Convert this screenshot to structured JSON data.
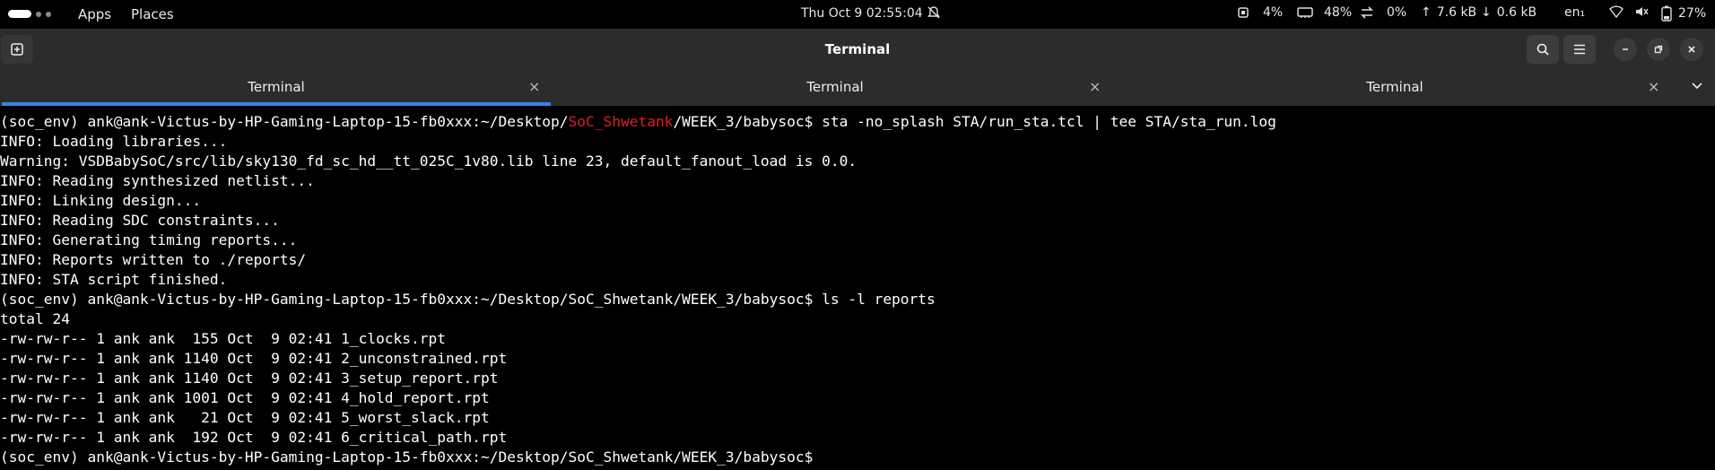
{
  "topbar": {
    "apps": "Apps",
    "places": "Places",
    "clock": "Thu Oct 9  02:55:04",
    "cpu": "4%",
    "mem": "48%",
    "swap": "0%",
    "up": "7.6 kB",
    "down": "0.6 kB",
    "lang": "en₁",
    "battery": "27%"
  },
  "header": {
    "title": "Terminal"
  },
  "tabs": [
    {
      "label": "Terminal",
      "active": true
    },
    {
      "label": "Terminal",
      "active": false
    },
    {
      "label": "Terminal",
      "active": false
    }
  ],
  "terminal": {
    "prompt_prefix": "(soc_env) ank@ank-Victus-by-HP-Gaming-Laptop-15-fb0xxx:~/Desktop/",
    "prompt_highlight": "SoC_Shwetank",
    "prompt_suffix": "/WEEK_3/babysoc$ sta -no_splash STA/run_sta.tcl | tee STA/sta_run.log",
    "lines": [
      "INFO: Loading libraries...",
      "Warning: VSDBabySoC/src/lib/sky130_fd_sc_hd__tt_025C_1v80.lib line 23, default_fanout_load is 0.0.",
      "INFO: Reading synthesized netlist...",
      "INFO: Linking design...",
      "INFO: Reading SDC constraints...",
      "INFO: Generating timing reports...",
      "INFO: Reports written to ./reports/",
      "INFO: STA script finished.",
      "(soc_env) ank@ank-Victus-by-HP-Gaming-Laptop-15-fb0xxx:~/Desktop/SoC_Shwetank/WEEK_3/babysoc$ ls -l reports",
      "total 24",
      "-rw-rw-r-- 1 ank ank  155 Oct  9 02:41 1_clocks.rpt",
      "-rw-rw-r-- 1 ank ank 1140 Oct  9 02:41 2_unconstrained.rpt",
      "-rw-rw-r-- 1 ank ank 1140 Oct  9 02:41 3_setup_report.rpt",
      "-rw-rw-r-- 1 ank ank 1001 Oct  9 02:41 4_hold_report.rpt",
      "-rw-rw-r-- 1 ank ank   21 Oct  9 02:41 5_worst_slack.rpt",
      "-rw-rw-r-- 1 ank ank  192 Oct  9 02:41 6_critical_path.rpt",
      "(soc_env) ank@ank-Victus-by-HP-Gaming-Laptop-15-fb0xxx:~/Desktop/SoC_Shwetank/WEEK_3/babysoc$"
    ]
  },
  "colors": {
    "accent": "#3584e4",
    "highlight_red": "#e01b24",
    "header_bg": "#2c2c2c"
  }
}
